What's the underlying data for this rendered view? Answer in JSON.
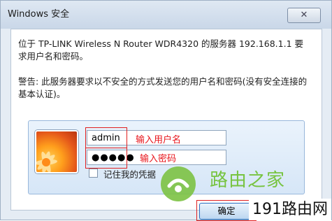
{
  "window": {
    "title": "Windows 安全",
    "close_label": "✕"
  },
  "message": {
    "line1": "位于 TP-LINK Wireless N Router WDR4320 的服务器  192.168.1.1  要求用户名和密码。",
    "warning": "警告: 此服务器要求以不安全的方式发送您的用户名和密码(没有安全连接的基本认证)。"
  },
  "credentials": {
    "username_value": "admin",
    "password_value": "●●●●●",
    "username_hint": "输入用户名",
    "password_hint": "输入密码",
    "remember_label": "记住我的凭据",
    "remember_checked": false
  },
  "buttons": {
    "ok_label": "确定"
  },
  "watermark": {
    "text": "路由之家"
  },
  "site_badge": {
    "text": "191路由网"
  },
  "colors": {
    "accent_red": "#e02020",
    "hint_red": "#e8141b",
    "watermark_green": "#6dc02d"
  }
}
